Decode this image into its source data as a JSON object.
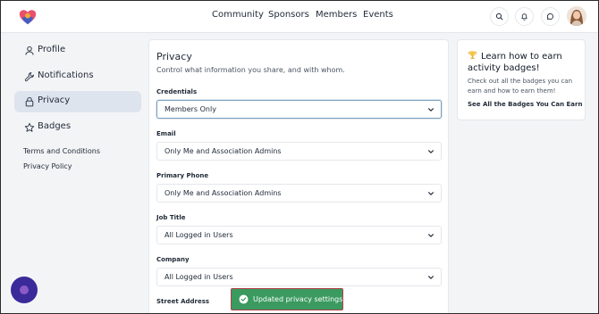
{
  "header": {
    "nav": [
      {
        "label": "Community"
      },
      {
        "label": "Sponsors"
      },
      {
        "label": "Members"
      },
      {
        "label": "Events"
      }
    ],
    "icons": [
      "search-icon",
      "bell-icon",
      "chat-icon"
    ]
  },
  "sidebar": {
    "items": [
      {
        "label": "Profile",
        "icon": "user-icon"
      },
      {
        "label": "Notifications",
        "icon": "wrench-icon"
      },
      {
        "label": "Privacy",
        "icon": "lock-icon",
        "active": true
      },
      {
        "label": "Badges",
        "icon": "star-icon"
      }
    ],
    "links": [
      {
        "label": "Terms and Conditions"
      },
      {
        "label": "Privacy Policy"
      }
    ]
  },
  "privacy": {
    "title": "Privacy",
    "subtitle": "Control what information you share, and with whom.",
    "fields": [
      {
        "label": "Credentials",
        "value": "Members Only"
      },
      {
        "label": "Email",
        "value": "Only Me and Association Admins"
      },
      {
        "label": "Primary Phone",
        "value": "Only Me and Association Admins"
      },
      {
        "label": "Job Title",
        "value": "All Logged in Users"
      },
      {
        "label": "Company",
        "value": "All Logged in Users"
      },
      {
        "label": "Street Address",
        "value": ""
      }
    ]
  },
  "badges_card": {
    "title": "Learn how to earn activity badges!",
    "body": "Check out all the badges you can earn and how to earn them!",
    "link": "See All the Badges You Can Earn"
  },
  "toast": {
    "message": "Updated privacy settings."
  },
  "colors": {
    "accent_active": "#dde4ee",
    "toast_bg": "#3a9a5f",
    "fab": "#3b2a9a"
  }
}
